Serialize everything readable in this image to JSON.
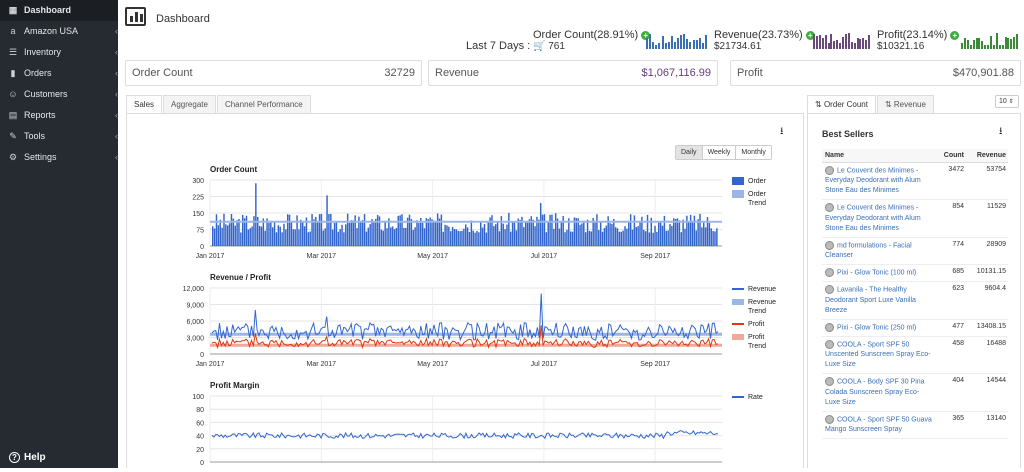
{
  "sidebar": {
    "items": [
      {
        "label": "Dashboard",
        "icon": "dashboard-icon",
        "active": true
      },
      {
        "label": "Amazon USA",
        "icon": "amazon-icon",
        "active": false
      },
      {
        "label": "Inventory",
        "icon": "list-icon",
        "active": false
      },
      {
        "label": "Orders",
        "icon": "bar-chart-icon",
        "active": false
      },
      {
        "label": "Customers",
        "icon": "users-icon",
        "active": false
      },
      {
        "label": "Reports",
        "icon": "reports-icon",
        "active": false
      },
      {
        "label": "Tools",
        "icon": "wrench-icon",
        "active": false
      },
      {
        "label": "Settings",
        "icon": "gear-icon",
        "active": false
      }
    ],
    "help": "Help"
  },
  "header": {
    "title": "Dashboard",
    "last7_label": "Last 7 Days :",
    "order": {
      "label": "Order Count(28.91%)",
      "value": "761"
    },
    "revenue": {
      "label": "Revenue(23.73%)",
      "value": "$21734.61"
    },
    "profit": {
      "label": "Profit(23.14%)",
      "value": "$10321.16"
    }
  },
  "summary": {
    "order_count": {
      "label": "Order Count",
      "value": "32729"
    },
    "revenue": {
      "label": "Revenue",
      "value": "$1,067,116.99"
    },
    "profit": {
      "label": "Profit",
      "value": "$470,901.88"
    }
  },
  "left_tabs": [
    "Sales",
    "Aggregate",
    "Channel Performance"
  ],
  "period_buttons": [
    "Daily",
    "Weekly",
    "Monthly"
  ],
  "right_tabs": [
    "Order Count",
    "Revenue"
  ],
  "page_size": "10",
  "best_sellers": {
    "title": "Best Sellers",
    "columns": [
      "Name",
      "Count",
      "Revenue"
    ],
    "rows": [
      {
        "name": "Le Couvent des Minimes - Everyday Deodorant with Alum Stone Eau des Minimes",
        "count": "3472",
        "revenue": "53754"
      },
      {
        "name": "Le Couvent des Minimes - Everyday Deodorant with Alum Stone Eau des Minimes",
        "count": "854",
        "revenue": "11529"
      },
      {
        "name": "md formulations - Facial Cleanser",
        "count": "774",
        "revenue": "28909"
      },
      {
        "name": "Pixi - Glow Tonic (100 ml)",
        "count": "685",
        "revenue": "10131.15"
      },
      {
        "name": "Lavanila - The Healthy Deodorant Sport Luxe Vanilla Breeze",
        "count": "623",
        "revenue": "9604.4"
      },
      {
        "name": "Pixi - Glow Tonic (250 ml)",
        "count": "477",
        "revenue": "13408.15"
      },
      {
        "name": "COOLA - Sport SPF 50 Unscented Sunscreen Spray Eco-Luxe Size",
        "count": "458",
        "revenue": "16488"
      },
      {
        "name": "COOLA - Body SPF 30 Pina Colada Sunscreen Spray Eco-Luxe Size",
        "count": "404",
        "revenue": "14544"
      },
      {
        "name": "COOLA - Sport SPF 50 Guava Mango Sunscreen Spray",
        "count": "365",
        "revenue": "13140"
      }
    ]
  },
  "colors": {
    "order": "#3366cc",
    "order_trend": "#9bb5e6",
    "profit": "#dc3912",
    "profit_trend": "#f0a899",
    "sidebar": "#262a31"
  },
  "chart_data": [
    {
      "type": "bar",
      "title": "Order Count",
      "x_ticks": [
        "Jan 2017",
        "Mar 2017",
        "May 2017",
        "Jul 2017",
        "Sep 2017"
      ],
      "y_ticks": [
        "300",
        "225",
        "150",
        "75",
        "0"
      ],
      "ylim": [
        0,
        300
      ],
      "series": [
        {
          "name": "Order",
          "color": "#3366cc"
        },
        {
          "name": "Order Trend",
          "color": "#9bb5e6"
        }
      ],
      "trend": [
        110,
        110
      ]
    },
    {
      "type": "line",
      "title": "Revenue / Profit",
      "x_ticks": [
        "Jan 2017",
        "Mar 2017",
        "May 2017",
        "Jul 2017",
        "Sep 2017"
      ],
      "y_ticks": [
        "12,000",
        "9,000",
        "6,000",
        "3,000",
        "0"
      ],
      "ylim": [
        0,
        12000
      ],
      "series": [
        {
          "name": "Revenue",
          "color": "#3366cc"
        },
        {
          "name": "Revenue Trend",
          "color": "#9bb5e6"
        },
        {
          "name": "Profit",
          "color": "#dc3912"
        },
        {
          "name": "Profit Trend",
          "color": "#f0a899"
        }
      ]
    },
    {
      "type": "line",
      "title": "Profit Margin",
      "y_ticks": [
        "100",
        "80",
        "60",
        "40",
        "20",
        "0"
      ],
      "ylim": [
        0,
        100
      ],
      "series": [
        {
          "name": "Rate",
          "color": "#3366cc"
        }
      ]
    }
  ]
}
